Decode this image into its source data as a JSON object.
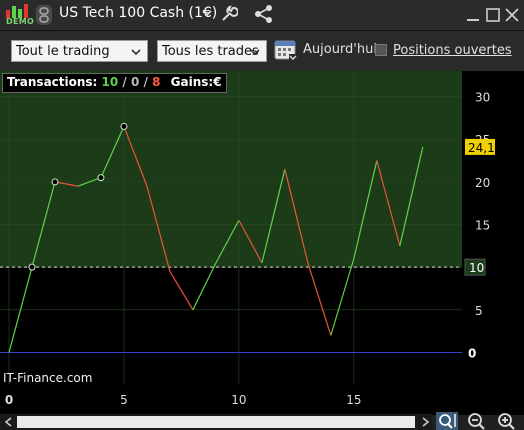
{
  "header": {
    "badge": "DEMO",
    "title": "US Tech 100 Cash (1€)"
  },
  "toolbar": {
    "trading_select": "Tout le trading",
    "trades_select": "Tous les trades",
    "today_label": "Aujourd'hui",
    "positions_label": "Positions ouvertes"
  },
  "stats": {
    "label": "Transactions:",
    "won": "10",
    "sep1": " / ",
    "neutral": "0",
    "sep2": " / ",
    "lost": "8",
    "gains_label": "Gains:",
    "gains_value": "€"
  },
  "watermark": "IT-Finance.com",
  "colors": {
    "up": "#5ed34a",
    "down": "#e8543a",
    "profit_zone": "#1c3b18",
    "zero_line": "#3344cc",
    "badge": "#f0d000"
  },
  "chart_data": {
    "type": "line",
    "x": [
      0,
      1,
      2,
      3,
      4,
      5,
      6,
      7,
      8,
      9,
      10,
      11,
      12,
      13,
      14,
      15,
      16,
      17,
      18
    ],
    "y": [
      0,
      10,
      20,
      19.5,
      20.5,
      26.5,
      19.5,
      9.5,
      5,
      10.5,
      15.5,
      10.5,
      21.5,
      10.5,
      2,
      11,
      22.5,
      12.5,
      24.1
    ],
    "xlim": [
      0,
      20
    ],
    "ylim": [
      -3.7,
      33
    ],
    "x_ticks": [
      0,
      5,
      10,
      15
    ],
    "y_ticks": [
      0,
      5,
      10,
      15,
      20,
      25,
      30
    ],
    "reference_line": 10,
    "reference_label": "10",
    "last_value_label": "24,1",
    "zero_label": "0",
    "markers_at_x": [
      1,
      2,
      4,
      5
    ]
  }
}
